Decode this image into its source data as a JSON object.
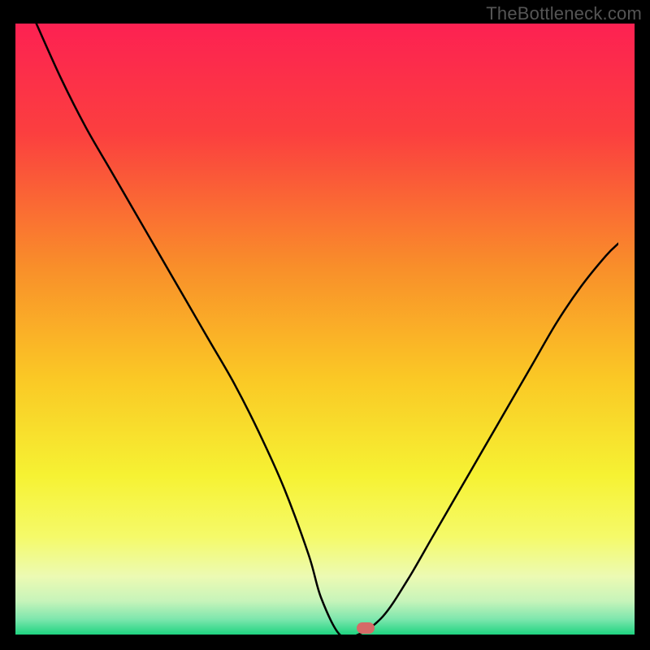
{
  "watermark": "TheBottleneck.com",
  "chart_data": {
    "type": "line",
    "title": "",
    "xlabel": "",
    "ylabel": "",
    "xlim": [
      0,
      100
    ],
    "ylim": [
      0,
      100
    ],
    "grid": false,
    "legend": false,
    "series": [
      {
        "name": "bottleneck-curve",
        "x": [
          6,
          10,
          14,
          18,
          22,
          26,
          30,
          34,
          38,
          42,
          46,
          50,
          52,
          55,
          58,
          62,
          66,
          70,
          74,
          78,
          82,
          86,
          90,
          94,
          98,
          100
        ],
        "values": [
          100,
          91,
          83,
          76,
          69,
          62,
          55,
          48,
          41,
          33,
          24,
          13,
          6,
          0,
          0,
          3,
          9,
          16,
          23,
          30,
          37,
          44,
          51,
          57,
          62,
          64
        ]
      }
    ],
    "marker": {
      "x": 56.5,
      "y": 0,
      "color": "#d66a67"
    },
    "gradient_stops": [
      {
        "offset": 0.0,
        "color": "#fd2152"
      },
      {
        "offset": 0.18,
        "color": "#fb3f3f"
      },
      {
        "offset": 0.4,
        "color": "#f98f2a"
      },
      {
        "offset": 0.58,
        "color": "#fac825"
      },
      {
        "offset": 0.74,
        "color": "#f6f233"
      },
      {
        "offset": 0.84,
        "color": "#f5fa69"
      },
      {
        "offset": 0.905,
        "color": "#ecfab3"
      },
      {
        "offset": 0.945,
        "color": "#c7f4ba"
      },
      {
        "offset": 0.975,
        "color": "#7de6ad"
      },
      {
        "offset": 1.0,
        "color": "#1fd480"
      }
    ]
  }
}
